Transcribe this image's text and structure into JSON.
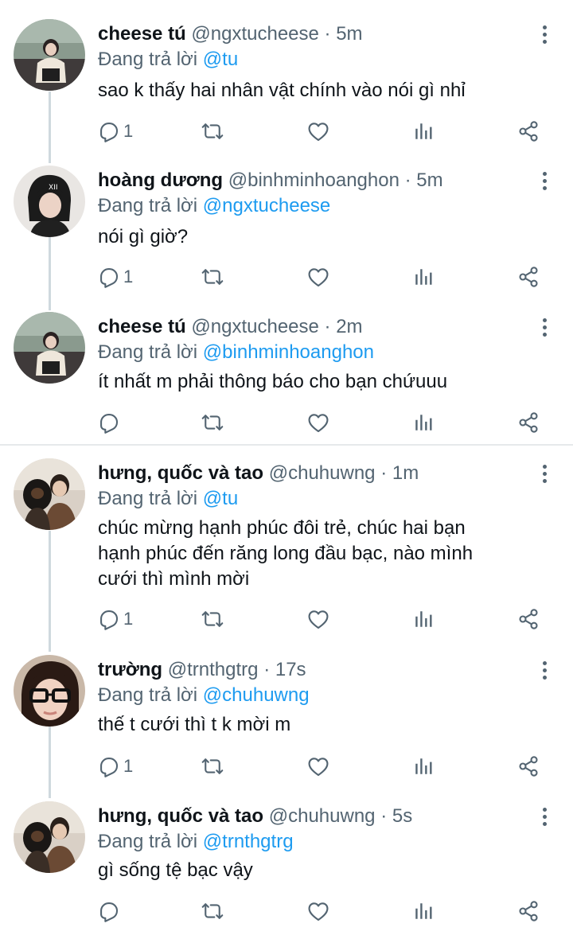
{
  "tweets": [
    {
      "name": "cheese tú",
      "handle": "@ngxtucheese",
      "time": "5m",
      "reply_prefix": "Đang trả lời",
      "reply_to": "@tu",
      "text": "sao k thấy hai nhân vật chính vào nói gì nhỉ",
      "reply_count": "1"
    },
    {
      "name": "hoàng dương",
      "handle": "@binhminhoanghon",
      "time": "5m",
      "reply_prefix": "Đang trả lời",
      "reply_to": "@ngxtucheese",
      "text": "nói gì giờ?",
      "reply_count": "1"
    },
    {
      "name": "cheese tú",
      "handle": "@ngxtucheese",
      "time": "2m",
      "reply_prefix": "Đang trả lời",
      "reply_to": "@binhminhoanghon",
      "text": "ít nhất m phải thông báo cho bạn chứuuu",
      "reply_count": ""
    },
    {
      "name": "hưng, quốc và tao",
      "handle": "@chuhuwng",
      "time": "1m",
      "reply_prefix": "Đang trả lời",
      "reply_to": "@tu",
      "text_lines": [
        "chúc mừng hạnh phúc đôi trẻ, chúc hai bạn",
        "hạnh phúc đến răng long đầu bạc, nào mình",
        "cưới thì mình mời"
      ],
      "reply_count": "1"
    },
    {
      "name": "trường",
      "handle": "@trnthgtrg",
      "time": "17s",
      "reply_prefix": "Đang trả lời",
      "reply_to": "@chuhuwng",
      "text": "thế t cưới thì t k mời m",
      "reply_count": "1"
    },
    {
      "name": "hưng, quốc và tao",
      "handle": "@chuhuwng",
      "time": "5s",
      "reply_prefix": "Đang trả lời",
      "reply_to": "@trnthgtrg",
      "text": "gì sống tệ bạc vậy",
      "reply_count": ""
    }
  ],
  "dot_separator": "·",
  "icons": {
    "reply": "reply-icon",
    "retweet": "retweet-icon",
    "like": "heart-icon",
    "views": "analytics-icon",
    "share": "share-icon",
    "more": "more-vertical-icon"
  },
  "colors": {
    "link": "#1d9bf0",
    "secondary": "#536471",
    "text": "#0f1419"
  }
}
